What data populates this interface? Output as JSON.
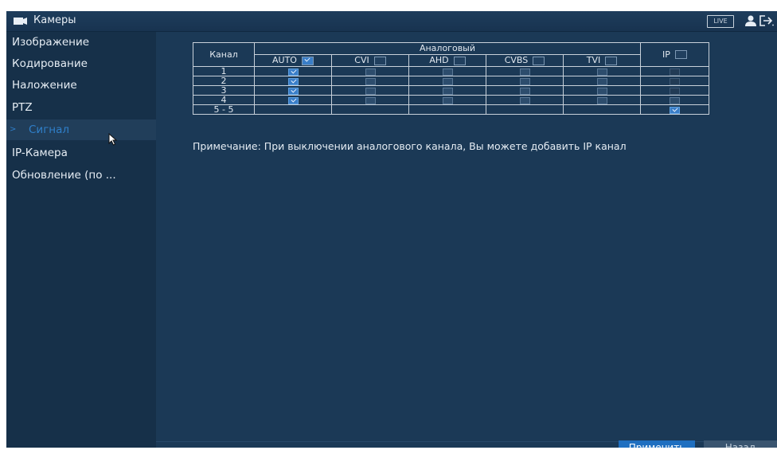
{
  "header": {
    "title": "Камеры",
    "live_label": "LIVE",
    "icons": [
      "camera-icon",
      "user-icon",
      "logout-icon"
    ]
  },
  "sidebar": {
    "items": [
      {
        "label": "Изображение",
        "active": false
      },
      {
        "label": "Кодирование",
        "active": false
      },
      {
        "label": "Наложение",
        "active": false
      },
      {
        "label": "PTZ",
        "active": false
      },
      {
        "label": "Сигнал",
        "active": true
      },
      {
        "label": "IP-Камера",
        "active": false
      },
      {
        "label": "Обновление (по ...",
        "active": false
      }
    ]
  },
  "table": {
    "channel_header": "Канал",
    "analog_header": "Аналоговый",
    "columns": [
      "AUTO",
      "CVI",
      "AHD",
      "CVBS",
      "TVI",
      "IP"
    ],
    "rows": [
      {
        "channel": "1",
        "auto": true,
        "cvi": false,
        "ahd": false,
        "cvbs": false,
        "tvi": false,
        "ip": false
      },
      {
        "channel": "2",
        "auto": true,
        "cvi": false,
        "ahd": false,
        "cvbs": false,
        "tvi": false,
        "ip": false
      },
      {
        "channel": "3",
        "auto": true,
        "cvi": false,
        "ahd": false,
        "cvbs": false,
        "tvi": false,
        "ip": false
      },
      {
        "channel": "4",
        "auto": true,
        "cvi": false,
        "ahd": false,
        "cvbs": false,
        "tvi": false,
        "ip": false
      },
      {
        "channel": "5 - 5",
        "auto": null,
        "cvi": null,
        "ahd": null,
        "cvbs": null,
        "tvi": null,
        "ip": true
      }
    ]
  },
  "note": "Примечание: При выключении аналогового канала, Вы можете добавить IP канал",
  "buttons": {
    "apply": "Применить",
    "back": "Назад"
  },
  "colors": {
    "background": "#1a3550",
    "accent": "#1f6fc0",
    "active_text": "#2f7fc9"
  }
}
